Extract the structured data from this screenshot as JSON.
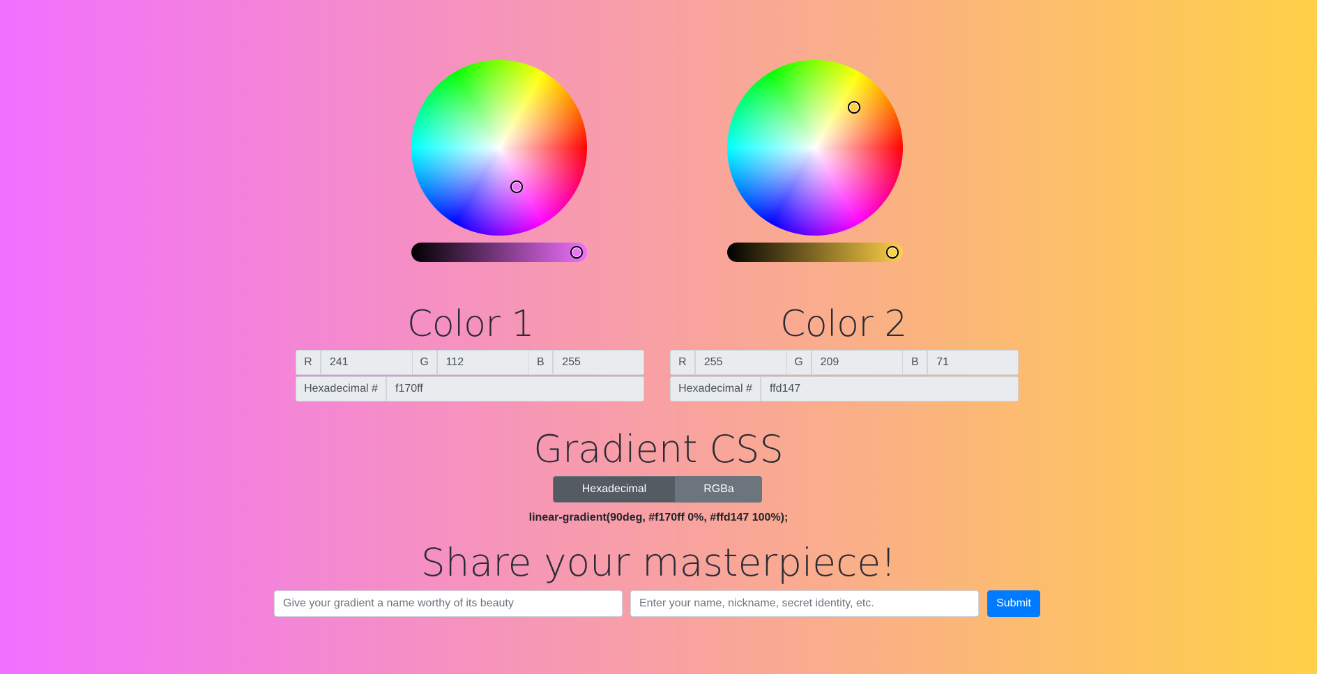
{
  "colors": {
    "page_gradient_start": "#f170ff",
    "page_gradient_end": "#ffd147",
    "submit_blue": "#007bff",
    "toggle_active": "#545b62",
    "toggle_inactive": "#6c757d"
  },
  "color1": {
    "title": "Color 1",
    "hex_color": "#f170ff",
    "r_label": "R",
    "r_value": "241",
    "g_label": "G",
    "g_value": "112",
    "b_label": "B",
    "b_value": "255",
    "hex_label": "Hexadecimal #",
    "hex_value": "f170ff"
  },
  "color2": {
    "title": "Color 2",
    "hex_color": "#ffd147",
    "r_label": "R",
    "r_value": "255",
    "g_label": "G",
    "g_value": "209",
    "b_label": "B",
    "b_value": "71",
    "hex_label": "Hexadecimal #",
    "hex_value": "ffd147"
  },
  "gradient": {
    "title": "Gradient CSS",
    "tabs": [
      {
        "label": "Hexadecimal",
        "active": true
      },
      {
        "label": "RGBa",
        "active": false
      }
    ],
    "css_text": "linear-gradient(90deg, #f170ff 0%, #ffd147 100%);"
  },
  "share": {
    "title": "Share your masterpiece!",
    "name_placeholder": "Give your gradient a name worthy of its beauty",
    "author_placeholder": "Enter your name, nickname, secret identity, etc.",
    "submit_label": "Submit"
  }
}
